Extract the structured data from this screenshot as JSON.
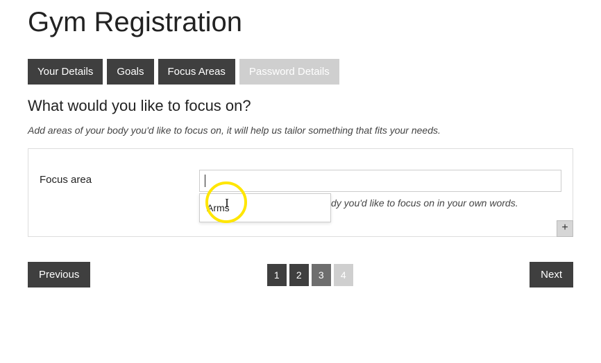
{
  "page": {
    "title": "Gym Registration"
  },
  "tabs": [
    {
      "label": "Your Details",
      "state": "normal"
    },
    {
      "label": "Goals",
      "state": "normal"
    },
    {
      "label": "Focus Areas",
      "state": "normal"
    },
    {
      "label": "Password Details",
      "state": "disabled"
    }
  ],
  "section": {
    "heading": "What would you like to focus on?",
    "description": "Add areas of your body you'd like to focus on, it will help us tailor something that fits your needs."
  },
  "form": {
    "focus_area": {
      "label": "Focus area",
      "value": "",
      "placeholder": "",
      "help": "dy you'd like to focus on in your own words.",
      "autocomplete": [
        "Arms"
      ]
    },
    "add_button": "+"
  },
  "nav": {
    "previous": "Previous",
    "next": "Next",
    "pages": [
      {
        "label": "1",
        "state": "normal"
      },
      {
        "label": "2",
        "state": "normal"
      },
      {
        "label": "3",
        "state": "muted"
      },
      {
        "label": "4",
        "state": "disabled"
      }
    ]
  }
}
